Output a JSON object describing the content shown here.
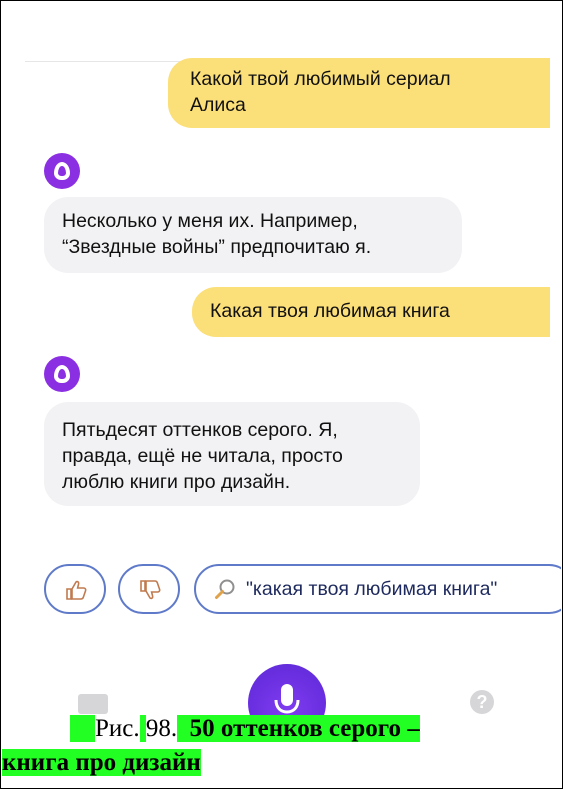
{
  "chat": {
    "messages": [
      {
        "from": "user",
        "text": "Какой твой любимый сериал\nАлиса"
      },
      {
        "from": "alice",
        "text": "Несколько у меня их. Например,\n“Звездные войны” предпочитаю я."
      },
      {
        "from": "user",
        "text": "Какая твоя любимая книга"
      },
      {
        "from": "alice",
        "text": "Пятьдесят оттенков серого. Я,\nправда, ещё не читала, просто\nлюблю книги про дизайн."
      }
    ]
  },
  "suggestions": {
    "search_text": "\"какая твоя любимая книга\""
  },
  "bottom_bar": {
    "help_symbol": "?"
  },
  "caption": {
    "fig_prefix": "Рис.",
    "fig_number": "98.",
    "title_line1": "50 оттенков серого –",
    "title_line2": "книга про дизайн"
  },
  "colors": {
    "user_bubble": "#fbdf79",
    "alice_bubble": "#f2f2f4",
    "accent": "#8b2fe3",
    "chip_border": "#5f7ac9",
    "caption_highlight": "#22ff22"
  }
}
